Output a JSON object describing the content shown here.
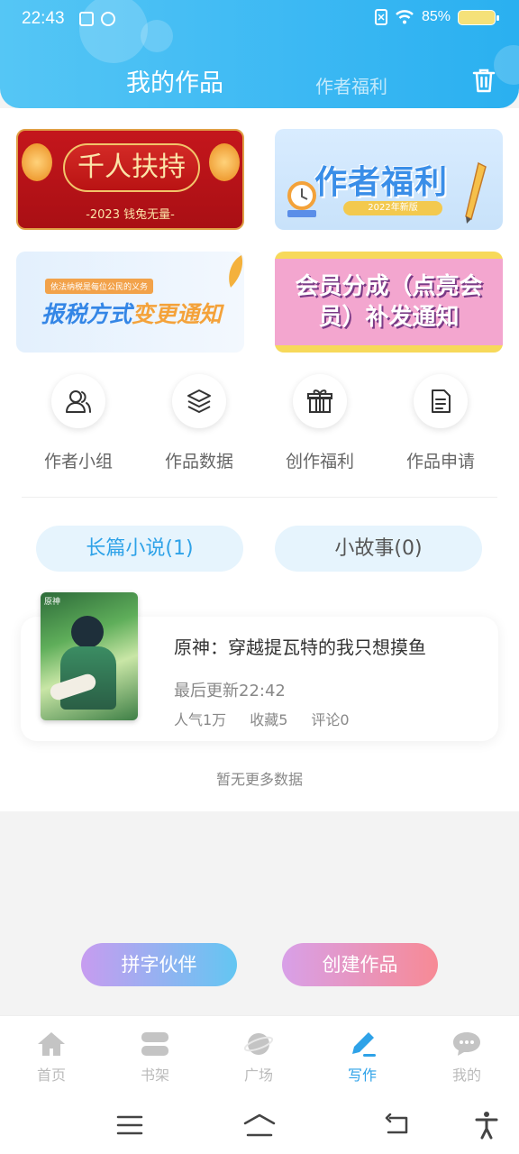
{
  "status": {
    "time": "22:43",
    "battery": "85%"
  },
  "header": {
    "tab_mine": "我的作品",
    "tab_welfare": "作者福利",
    "trash_icon": "trash-icon",
    "accent": "#3bb8f3"
  },
  "banners": {
    "b1": {
      "title": "千人扶持",
      "sub": "-2023 钱兔无量-"
    },
    "b2": {
      "title": "作者福利",
      "pill": "2022年新版"
    },
    "b3": {
      "small": "依法纳税是每位公民的义务",
      "title_a": "报税方式",
      "title_b": "变更通知"
    },
    "b4": {
      "line1": "会员分成（点亮会",
      "line2": "员）补发通知"
    }
  },
  "quick_actions": [
    {
      "label": "作者小组",
      "icon": "author-group-icon"
    },
    {
      "label": "作品数据",
      "icon": "layers-icon"
    },
    {
      "label": "创作福利",
      "icon": "gift-icon"
    },
    {
      "label": "作品申请",
      "icon": "document-icon"
    }
  ],
  "segments": {
    "novel": "长篇小说(1)",
    "story": "小故事(0)"
  },
  "book": {
    "cover_tag": "原神",
    "title": "原神：穿越提瓦特的我只想摸鱼",
    "updated": "最后更新22:42",
    "popularity": "人气1万",
    "favorites": "收藏5",
    "comments": "评论0"
  },
  "no_more": "暂无更多数据",
  "buttons": {
    "partner": "拼字伙伴",
    "create": "创建作品"
  },
  "tabbar": [
    {
      "label": "首页",
      "icon": "home-icon"
    },
    {
      "label": "书架",
      "icon": "bookshelf-icon"
    },
    {
      "label": "广场",
      "icon": "planet-icon"
    },
    {
      "label": "写作",
      "icon": "pen-icon",
      "active": true
    },
    {
      "label": "我的",
      "icon": "chat-icon"
    }
  ]
}
